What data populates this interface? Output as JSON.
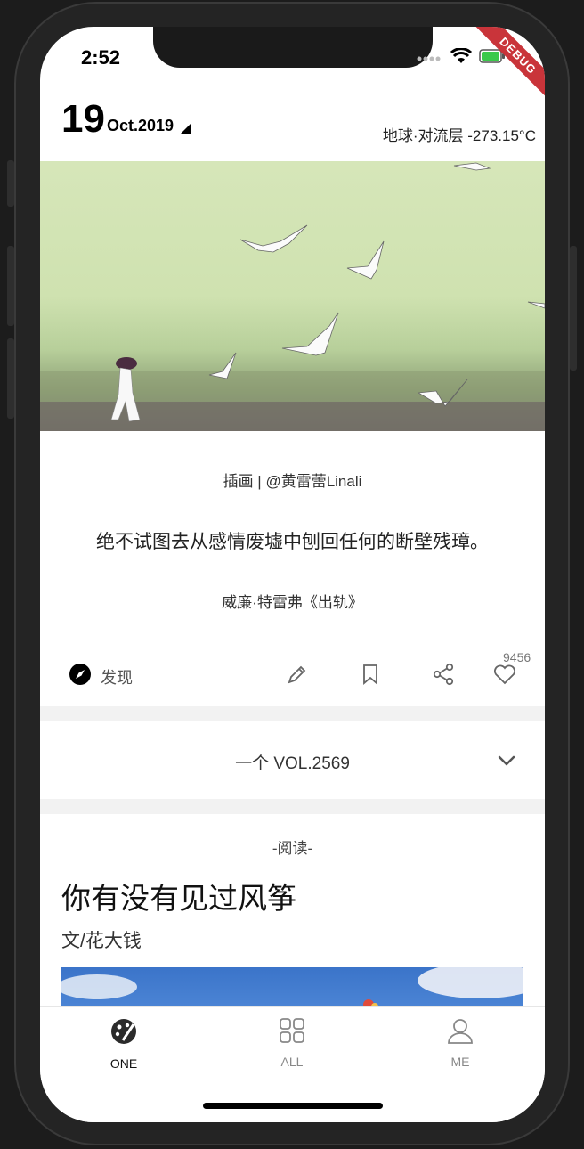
{
  "status": {
    "time": "2:52",
    "debug_banner": "DEBUG"
  },
  "header": {
    "day": "19",
    "month_year": "Oct.2019",
    "weather": "地球·对流层 -273.15°C"
  },
  "cover": {
    "caption": "插画 | @黄雷蕾Linali",
    "quote": "绝不试图去从感情废墟中刨回任何的断壁残璋。",
    "source": "威廉·特雷弗《出轨》"
  },
  "actions": {
    "discover_label": "发现",
    "like_count": "9456"
  },
  "volume": {
    "label": "一个 VOL.2569"
  },
  "article": {
    "tag": "-阅读-",
    "title": "你有没有见过风筝",
    "author": "文/花大钱"
  },
  "tabs": [
    {
      "label": "ONE",
      "icon": "palette-icon",
      "active": true
    },
    {
      "label": "ALL",
      "icon": "grid-icon",
      "active": false
    },
    {
      "label": "ME",
      "icon": "person-icon",
      "active": false
    }
  ],
  "colors": {
    "active_tab": "#111111",
    "inactive_tab": "#888888",
    "divider": "#f2f2f2"
  }
}
